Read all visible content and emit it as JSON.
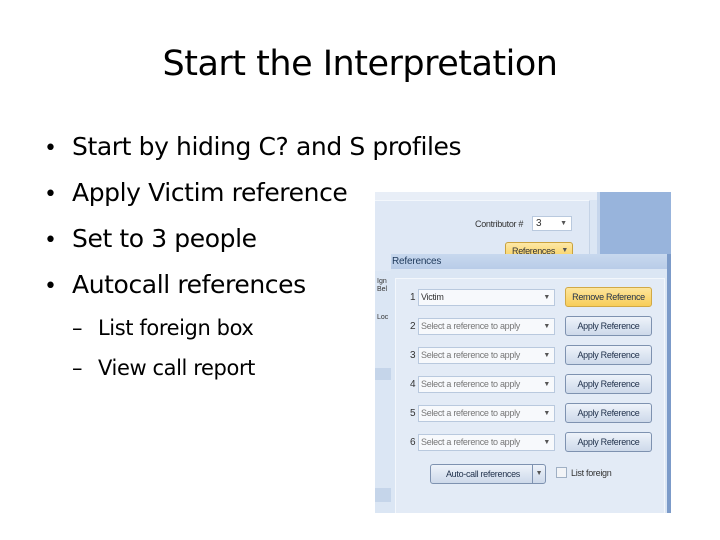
{
  "slide": {
    "title": "Start the Interpretation",
    "bullets": [
      "Start by hiding C? and S profiles",
      "Apply Victim reference",
      "Set to 3 people",
      "Autocall references"
    ],
    "sub_bullets": [
      "List foreign box",
      "View call report"
    ],
    "bullet_glyph": "•",
    "dash_glyph": "–"
  },
  "screenshot": {
    "contributor_label": "Contributor #",
    "contributor_value": "3",
    "references_dropdown_label": "References",
    "window_title": "References",
    "side_labels": [
      "Ign",
      "Bel",
      "Loc"
    ],
    "rows": [
      {
        "num": "1",
        "value": "Victim",
        "button": "Remove Reference",
        "filled": true
      },
      {
        "num": "2",
        "value": "Select a reference to apply",
        "button": "Apply Reference",
        "filled": false
      },
      {
        "num": "3",
        "value": "Select a reference to apply",
        "button": "Apply Reference",
        "filled": false
      },
      {
        "num": "4",
        "value": "Select a reference to apply",
        "button": "Apply Reference",
        "filled": false
      },
      {
        "num": "5",
        "value": "Select a reference to apply",
        "button": "Apply Reference",
        "filled": false
      },
      {
        "num": "6",
        "value": "Select a reference to apply",
        "button": "Apply Reference",
        "filled": false
      }
    ],
    "autocall_label": "Auto-call references",
    "list_foreign_label": "List foreign",
    "list_foreign_checked": false,
    "caret_glyph": "▼"
  }
}
